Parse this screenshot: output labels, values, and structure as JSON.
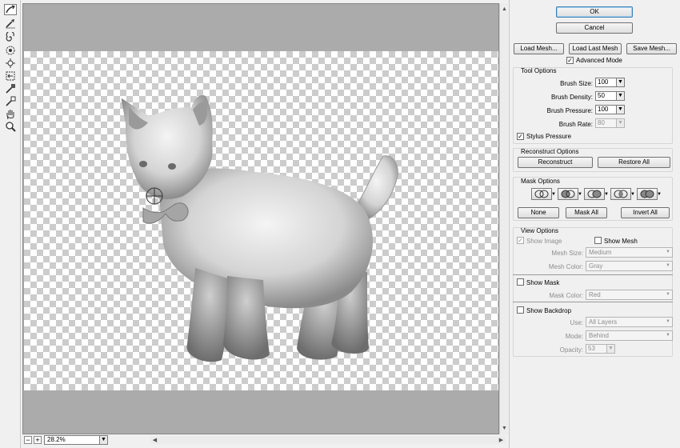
{
  "toolbar": {
    "tools": [
      {
        "name": "forward-warp-icon",
        "active": true
      },
      {
        "name": "reconstruct-icon"
      },
      {
        "name": "twirl-clockwise-icon"
      },
      {
        "name": "pucker-icon"
      },
      {
        "name": "bloat-icon"
      },
      {
        "name": "push-left-icon"
      },
      {
        "name": "freeze-mask-icon"
      },
      {
        "name": "thaw-mask-icon"
      },
      {
        "name": "hand-icon"
      },
      {
        "name": "zoom-icon"
      }
    ]
  },
  "canvas": {
    "zoom": "28.2%"
  },
  "dialog": {
    "ok_label": "OK",
    "cancel_label": "Cancel",
    "load_mesh_label": "Load Mesh...",
    "load_last_mesh_label": "Load Last Mesh",
    "save_mesh_label": "Save Mesh...",
    "advanced_mode_label": "Advanced Mode",
    "advanced_mode_checked": true
  },
  "tool_options": {
    "title": "Tool Options",
    "brush_size_label": "Brush Size:",
    "brush_size": "100",
    "brush_density_label": "Brush Density:",
    "brush_density": "50",
    "brush_pressure_label": "Brush Pressure:",
    "brush_pressure": "100",
    "brush_rate_label": "Brush Rate:",
    "brush_rate": "80",
    "stylus_pressure_label": "Stylus Pressure",
    "stylus_pressure_checked": true
  },
  "reconstruct_options": {
    "title": "Reconstruct Options",
    "reconstruct_label": "Reconstruct",
    "restore_all_label": "Restore All"
  },
  "mask_options": {
    "title": "Mask Options",
    "none_label": "None",
    "mask_all_label": "Mask All",
    "invert_all_label": "Invert All"
  },
  "view_options": {
    "title": "View Options",
    "show_image_label": "Show Image",
    "show_image_checked": true,
    "show_mesh_label": "Show Mesh",
    "show_mesh_checked": false,
    "mesh_size_label": "Mesh Size:",
    "mesh_size": "Medium",
    "mesh_color_label": "Mesh Color:",
    "mesh_color": "Gray",
    "show_mask_label": "Show Mask",
    "show_mask_checked": false,
    "mask_color_label": "Mask Color:",
    "mask_color": "Red",
    "show_backdrop_label": "Show Backdrop",
    "show_backdrop_checked": false,
    "use_label": "Use:",
    "use": "All Layers",
    "mode_label": "Mode:",
    "mode": "Behind",
    "opacity_label": "Opacity:",
    "opacity": "53"
  }
}
